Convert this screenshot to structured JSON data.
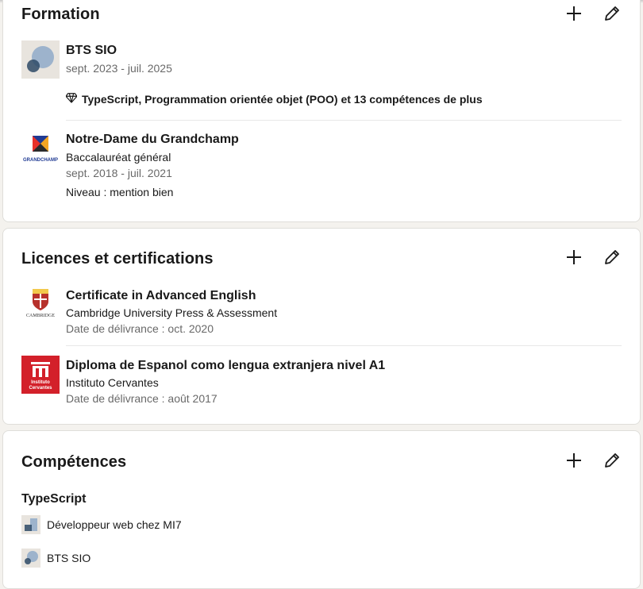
{
  "formation": {
    "title": "Formation",
    "add_icon": "plus-icon",
    "edit_icon": "pencil-icon",
    "items": [
      {
        "school": "BTS SIO",
        "dates": "sept. 2023 - juil. 2025",
        "skills": "TypeScript, Programmation orientée objet (POO) et 13 compétences de plus",
        "skills_icon": "diamond-icon"
      },
      {
        "school": "Notre-Dame du Grandchamp",
        "degree": "Baccalauréat général",
        "dates": "sept. 2018 - juil. 2021",
        "grade": "Niveau : mention bien",
        "logo_text": "GRANDCHAMP"
      }
    ]
  },
  "licences": {
    "title": "Licences et certifications",
    "items": [
      {
        "name": "Certificate in Advanced English",
        "issuer": "Cambridge University Press & Assessment",
        "issued": "Date de délivrance : oct. 2020",
        "logo_text": "CAMBRIDGE"
      },
      {
        "name": "Diploma de Espanol como lengua extranjera nivel A1",
        "issuer": "Instituto Cervantes",
        "issued": "Date de délivrance : août 2017",
        "logo_line1": "Instituto",
        "logo_line2": "Cervantes"
      }
    ]
  },
  "competences": {
    "title": "Compétences",
    "skill": "TypeScript",
    "associations": [
      {
        "label": "Développeur web chez MI7"
      },
      {
        "label": "BTS SIO"
      }
    ]
  },
  "colors": {
    "cervantes_red": "#d3202a",
    "placeholder_blue": "#9db3cc",
    "placeholder_dark": "#2e4a66"
  }
}
